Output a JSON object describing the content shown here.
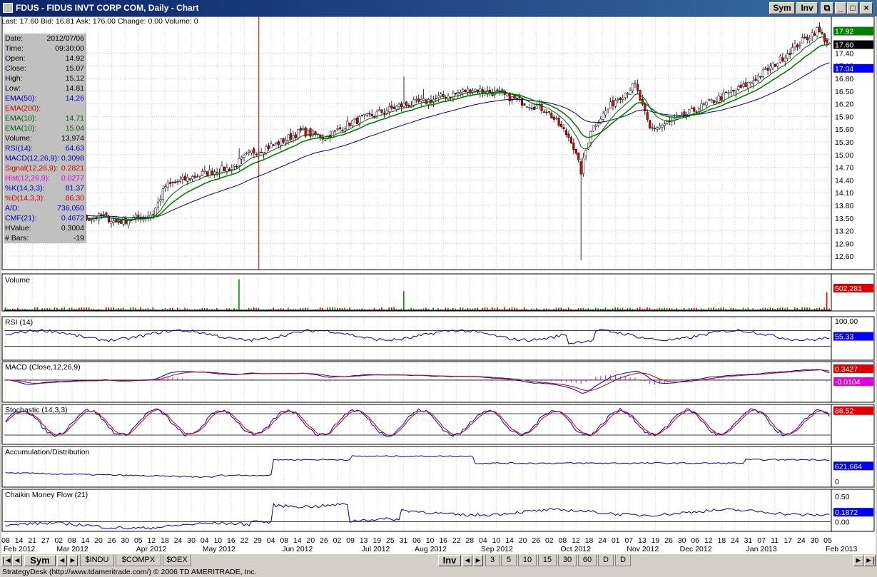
{
  "window": {
    "title": "FDUS - FIDUS INVT CORP COM, Daily - Chart",
    "buttons": [
      "Sym",
      "Inv"
    ]
  },
  "info_bar": {
    "last": "Last: 17.60",
    "bid": "Bid: 16.81",
    "ask": "Ask: 176.00",
    "change": "Change: 0.00",
    "volume": "Volume: 0"
  },
  "data_panel": [
    {
      "label": "Date:",
      "value": "2012/07/06",
      "color": "#000000"
    },
    {
      "label": "Time:",
      "value": "09:30:00",
      "color": "#000000"
    },
    {
      "label": "Open:",
      "value": "14.92",
      "color": "#000000"
    },
    {
      "label": "Close:",
      "value": "15.07",
      "color": "#000000"
    },
    {
      "label": "High:",
      "value": "15.12",
      "color": "#000000"
    },
    {
      "label": "Low:",
      "value": "14.81",
      "color": "#000000"
    },
    {
      "label": "EMA(50):",
      "value": "14.26",
      "color": "#0000c0"
    },
    {
      "label": "EMA(200):",
      "value": "",
      "color": "#d00000"
    },
    {
      "label": "EMA(10):",
      "value": "14.71",
      "color": "#006000"
    },
    {
      "label": "EMA(10):",
      "value": "15.04",
      "color": "#006000"
    },
    {
      "label": "Volume:",
      "value": "13,974",
      "color": "#000000"
    },
    {
      "label": "RSI(14):",
      "value": "64.63",
      "color": "#0000c0"
    },
    {
      "label": "MACD(12,26,9):",
      "value": "0.3098",
      "color": "#0000c0"
    },
    {
      "label": "Signal(12,26,9):",
      "value": "0.2821",
      "color": "#d00000"
    },
    {
      "label": "Hist(12,26,9):",
      "value": "0.0277",
      "color": "#e000e0"
    },
    {
      "label": "%K(14,3,3):",
      "value": "81.37",
      "color": "#0000c0"
    },
    {
      "label": "%D(14,3,3):",
      "value": "86.30",
      "color": "#d00000"
    },
    {
      "label": "A/D:",
      "value": "736,050",
      "color": "#0000c0"
    },
    {
      "label": "CMF(21):",
      "value": "0.4672",
      "color": "#0000c0"
    },
    {
      "label": "HValue:",
      "value": "0.3004",
      "color": "#000000"
    },
    {
      "label": "# Bars:",
      "value": "-19",
      "color": "#000000"
    }
  ],
  "chart_data": {
    "type": "candlestick",
    "symbol": "FDUS",
    "price_axis_ticks": [
      17.4,
      17.1,
      16.8,
      16.5,
      16.2,
      15.9,
      15.6,
      15.3,
      15.0,
      14.7,
      14.4,
      14.1,
      13.8,
      13.5,
      13.2,
      12.9,
      12.6
    ],
    "price_range": [
      12.35,
      18.2
    ],
    "price_tags": [
      {
        "value": "17.92",
        "price": 17.92,
        "color": "#008000"
      },
      {
        "value": "17.60",
        "price": 17.6,
        "color": "#000000"
      },
      {
        "value": "17.04",
        "price": 17.04,
        "color": "#0000ff"
      }
    ],
    "date_ticks": [
      "08",
      "14",
      "21",
      "27",
      "02",
      "08",
      "14",
      "20",
      "26",
      "30",
      "05",
      "12",
      "18",
      "24",
      "30",
      "04",
      "10",
      "16",
      "22",
      "29",
      "04",
      "08",
      "14",
      "20",
      "26",
      "02",
      "09",
      "13",
      "19",
      "25",
      "31",
      "06",
      "10",
      "16",
      "22",
      "28",
      "04",
      "10",
      "14",
      "20",
      "26",
      "02",
      "08",
      "12",
      "18",
      "24",
      "01",
      "07",
      "13",
      "19",
      "26",
      "30",
      "06",
      "12",
      "18",
      "24",
      "31",
      "07",
      "11",
      "17",
      "24",
      "30",
      "05"
    ],
    "month_labels": [
      "Feb 2012",
      "Mar 2012",
      "Apr 2012",
      "May 2012",
      "Jun 2012",
      "Jul 2012",
      "Aug 2012",
      "Sep 2012",
      "Oct 2012",
      "Nov 2012",
      "Dec 2012",
      "Jan 2013",
      "Feb 2013"
    ],
    "month_positions": [
      0,
      4,
      10,
      15,
      21,
      27,
      31,
      36,
      42,
      47,
      51,
      56,
      62
    ],
    "cursor_date": "2012/07/06",
    "close_keypoints": [
      [
        0,
        13.85
      ],
      [
        8,
        13.2
      ],
      [
        14,
        13.55
      ],
      [
        22,
        13.45
      ],
      [
        34,
        13.5
      ],
      [
        40,
        13.55
      ],
      [
        45,
        13.4
      ],
      [
        60,
        13.6
      ],
      [
        65,
        14.25
      ],
      [
        80,
        14.55
      ],
      [
        92,
        14.7
      ],
      [
        100,
        15.05
      ],
      [
        110,
        15.25
      ],
      [
        120,
        15.55
      ],
      [
        130,
        15.4
      ],
      [
        140,
        15.75
      ],
      [
        150,
        15.95
      ],
      [
        160,
        16.15
      ],
      [
        170,
        16.25
      ],
      [
        180,
        16.4
      ],
      [
        190,
        16.55
      ],
      [
        200,
        16.45
      ],
      [
        210,
        16.25
      ],
      [
        220,
        16.05
      ],
      [
        230,
        15.35
      ],
      [
        234,
        14.6
      ],
      [
        238,
        15.6
      ],
      [
        248,
        16.3
      ],
      [
        256,
        16.65
      ],
      [
        262,
        15.6
      ],
      [
        272,
        15.8
      ],
      [
        285,
        16.2
      ],
      [
        300,
        16.6
      ],
      [
        312,
        17.1
      ],
      [
        322,
        17.6
      ],
      [
        330,
        17.95
      ],
      [
        335,
        17.6
      ]
    ],
    "volume_axis": {
      "max_label": "502,281",
      "spikes": [
        {
          "bar": 95,
          "value": 502281
        },
        {
          "bar": 162,
          "value": 310000
        },
        {
          "bar": 334,
          "value": 290000
        }
      ]
    },
    "rsi": {
      "title": "RSI (14)",
      "top": "100.00",
      "current": "55.33",
      "levels": [
        70,
        30
      ]
    },
    "macd": {
      "title": "MACD (Close,12,26,9)",
      "current": "0.3427",
      "hist_current": "-0.0104"
    },
    "stochastic": {
      "title": "Stochastic (14,3,3)",
      "current": "88.52",
      "levels": [
        80,
        20
      ]
    },
    "ad": {
      "title": "Accumulation/Distribution",
      "current": "621,664",
      "zero": "0"
    },
    "cmf": {
      "title": "Chaikin Money Flow (21)",
      "top": "0.50",
      "current": "0.1872",
      "zero": "0.00"
    }
  },
  "bottom_bar": {
    "sym_button": "Sym",
    "symbol_tabs": [
      "$INDU",
      "$COMPX",
      "$OEX"
    ],
    "inv_button": "Inv",
    "interval_tabs": [
      "3",
      "5",
      "10",
      "15",
      "30",
      "60",
      "D",
      "D"
    ]
  },
  "status": "StrategyDesk (http://www.tdameritrade.com/) © 2006 TD AMERITRADE, Inc."
}
